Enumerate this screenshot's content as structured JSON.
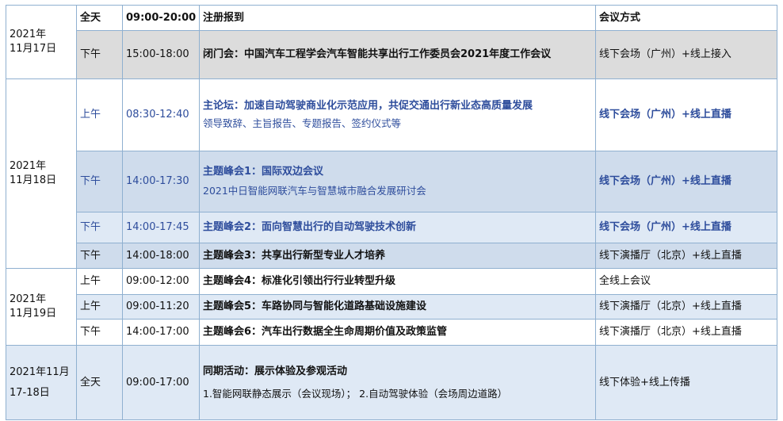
{
  "schedule": {
    "header": {
      "time_span": "全天",
      "hours": "09:00-20:00",
      "title": "注册报到",
      "mode": "会议方式"
    },
    "day17": {
      "date_line1": "2021年",
      "date_line2": "11月17日",
      "row1": {
        "period": "下午",
        "time": "15:00-18:00",
        "title": "闭门会：中国汽车工程学会汽车智能共享出行工作委员会2021年度工作会议",
        "mode": "线下会场（广州）+线上接入"
      }
    },
    "day18": {
      "date_line1": "2021年",
      "date_line2": "11月18日",
      "row1": {
        "period": "上午",
        "time": "08:30-12:40",
        "title": "主论坛：加速自动驾驶商业化示范应用，共促交通出行新业态高质量发展",
        "subtitle": "领导致辞、主旨报告、专题报告、签约仪式等",
        "mode": "线下会场（广州）+线上直播"
      },
      "row2": {
        "period": "下午",
        "time": "14:00-17:30",
        "title": "主题峰会1：国际双边会议",
        "subtitle": "2021中日智能网联汽车与智慧城市融合发展研讨会",
        "mode": "线下会场（广州）+线上直播"
      },
      "row3": {
        "period": "下午",
        "time": "14:00-17:45",
        "title": "主题峰会2：面向智慧出行的自动驾驶技术创新",
        "mode": "线下会场（广州）+线上直播"
      },
      "row4": {
        "period": "下午",
        "time": "14:00-18:00",
        "title": "主题峰会3：共享出行新型专业人才培养",
        "mode": "线下演播厅（北京）+线上直播"
      }
    },
    "day19": {
      "date_line1": "2021年",
      "date_line2": "11月19日",
      "row1": {
        "period": "上午",
        "time": "09:00-12:00",
        "title": "主题峰会4：标准化引领出行行业转型升级",
        "mode": "全线上会议"
      },
      "row2": {
        "period": "上午",
        "time": "09:00-11:20",
        "title": "主题峰会5：车路协同与智能化道路基础设施建设",
        "mode": "线下演播厅（北京）+线上直播"
      },
      "row3": {
        "period": "下午",
        "time": "14:00-17:00",
        "title": "主题峰会6：汽车出行数据全生命周期价值及政策监管",
        "mode": "线下演播厅（北京）+线上直播"
      }
    },
    "span": {
      "date_line1": "2021年11月",
      "date_line2": "17-18日",
      "period": "全天",
      "time": "09:00-17:00",
      "title": "同期活动：展示体验及参观活动",
      "subtitle": "1.智能网联静态展示（会议现场）；  2.自动驾驶体验（会场周边道路）",
      "mode": "线下体验+线上传播"
    }
  }
}
